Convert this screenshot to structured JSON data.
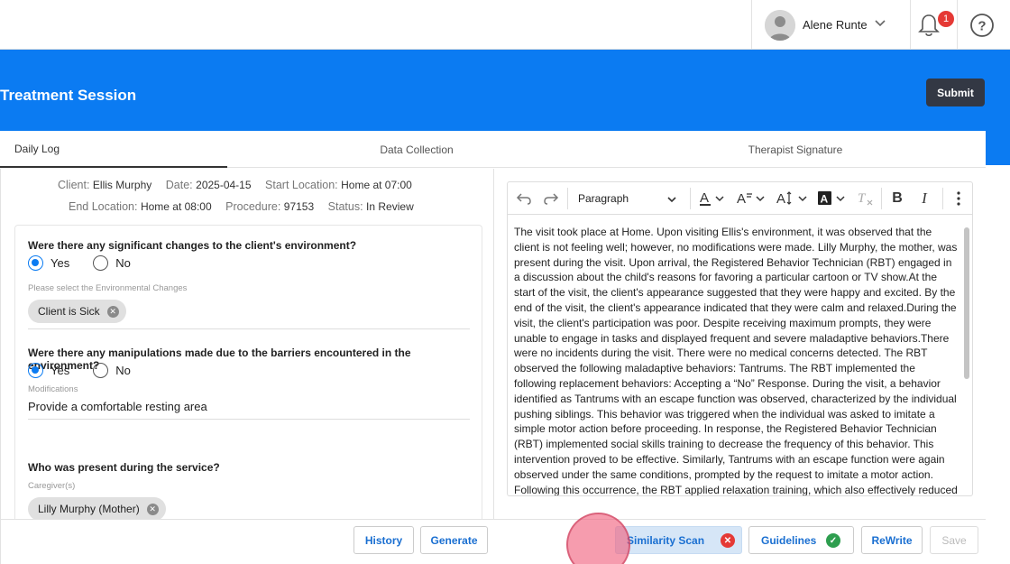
{
  "topbar": {
    "user_name": "Alene Runte",
    "notification_count": "1"
  },
  "header": {
    "title": "Treatment Session",
    "submit_label": "Submit"
  },
  "tabs": [
    "Daily Log",
    "Data Collection",
    "Therapist Signature"
  ],
  "session_info": {
    "client_label": "Client:",
    "client": "Ellis Murphy",
    "date_label": "Date:",
    "date": "2025-04-15",
    "start_label": "Start Location:",
    "start": "Home at 07:00",
    "end_label": "End Location:",
    "end": "Home at 08:00",
    "procedure_label": "Procedure:",
    "procedure": "97153",
    "status_label": "Status:",
    "status": "In Review"
  },
  "form": {
    "q1": "Were there any significant changes to the client's environment?",
    "q1_yes": "Yes",
    "q1_no": "No",
    "q1_sub_label": "Please select the Environmental Changes",
    "q1_chip": "Client is Sick",
    "q2": "Were there any manipulations made due to the barriers encountered in the environment?",
    "q2_yes": "Yes",
    "q2_no": "No",
    "q2_sub_label": "Modifications",
    "q2_value": "Provide a comfortable resting area",
    "q3": "Who was present during the service?",
    "q3_sub_label": "Caregiver(s)",
    "q3_chip": "Lilly Murphy (Mother)"
  },
  "left_footer": {
    "history": "History",
    "generate": "Generate"
  },
  "editor": {
    "paragraph_select": "Paragraph",
    "content": "The visit took place at Home. Upon visiting Ellis's environment, it was observed that the client is not feeling well; however, no modifications were made. Lilly Murphy, the mother, was present during the visit. Upon arrival, the Registered Behavior Technician (RBT) engaged in a discussion about the child's reasons for favoring a particular cartoon or TV show.At the start of the visit, the client's appearance suggested that they were happy and excited. By the end of the visit, the client's appearance indicated that they were calm and relaxed.During the visit, the client's participation was poor. Despite receiving maximum prompts, they were unable to engage in tasks and displayed frequent and severe maladaptive behaviors.There were no incidents during the visit. There were no medical concerns detected. The RBT observed the following maladaptive behaviors: Tantrums. The RBT implemented the following replacement behaviors: Accepting a “No” Response. During the visit, a behavior identified as Tantrums with an escape function was observed, characterized by the individual pushing siblings. This behavior was triggered when the individual was asked to imitate a simple motor action before proceeding. In response, the Registered Behavior Technician (RBT) implemented social skills training to decrease the frequency of this behavior. This intervention proved to be effective. Similarly, Tantrums with an escape function were again observed under the same conditions, prompted by the request to imitate a motor action. Following this occurrence, the RBT applied relaxation training, which also effectively reduced the behavior's frequency. Additionally,"
  },
  "right_footer": {
    "similarity_scan": "Similarity Scan",
    "guidelines": "Guidelines",
    "rewrite": "ReWrite",
    "save": "Save"
  },
  "colors": {
    "brand_blue": "#0b7bf2",
    "error_red": "#e53935",
    "success_green": "#2e9e4f"
  }
}
